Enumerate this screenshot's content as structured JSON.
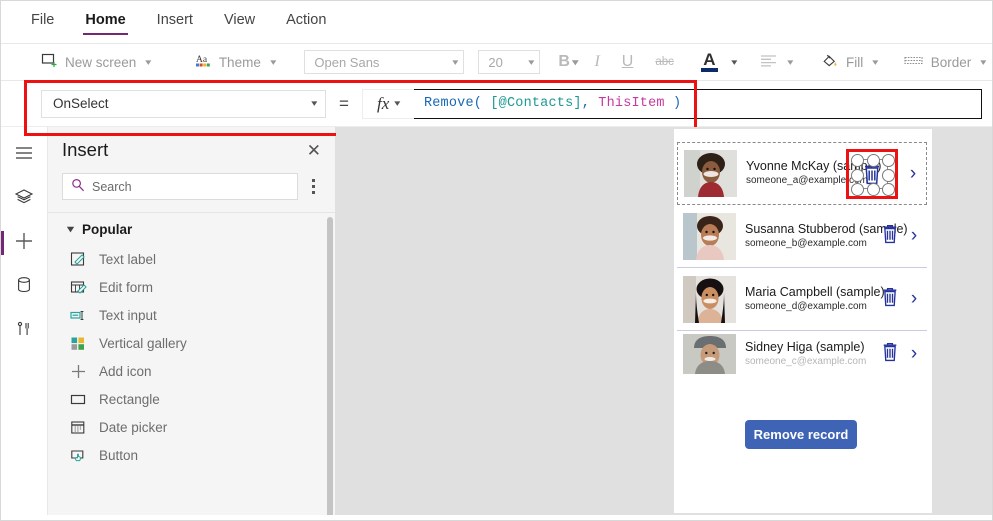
{
  "app": {
    "name": "Power Apps Studio",
    "accent": "#742774",
    "canvas_bg": "#e0e0e0",
    "annotation_color": "#ee1111"
  },
  "menubar": {
    "items": [
      {
        "label": "File",
        "active": false
      },
      {
        "label": "Home",
        "active": true
      },
      {
        "label": "Insert",
        "active": false
      },
      {
        "label": "View",
        "active": false
      },
      {
        "label": "Action",
        "active": false
      }
    ]
  },
  "toolbar": {
    "new_screen": "New screen",
    "theme": "Theme",
    "font_name": "Open Sans",
    "font_size": "20",
    "bold": "B",
    "italic": "I",
    "underline": "U",
    "strikethrough": "abc",
    "font_color": "A",
    "align": "align",
    "fill": "Fill",
    "border": "Border"
  },
  "formula_bar": {
    "property": "OnSelect",
    "equals": "=",
    "fx": "fx",
    "formula_tokens": [
      {
        "text": "Remove(",
        "color": "#1767b5"
      },
      {
        "text": " ",
        "color": "#1b1b1b"
      },
      {
        "text": "[@Contacts]",
        "color": "#1b9a93"
      },
      {
        "text": ", ",
        "color": "#1767b5"
      },
      {
        "text": "ThisItem",
        "color": "#c7399b"
      },
      {
        "text": " )",
        "color": "#1767b5"
      }
    ],
    "formula_plain": "Remove( [@Contacts], ThisItem )"
  },
  "rail": {
    "items": [
      {
        "name": "hamburger-menu-icon",
        "label": "Menu"
      },
      {
        "name": "tree-view-icon",
        "label": "Tree view"
      },
      {
        "name": "insert-icon",
        "label": "Insert",
        "selected": true
      },
      {
        "name": "data-icon",
        "label": "Data"
      },
      {
        "name": "tools-icon",
        "label": "Advanced"
      }
    ]
  },
  "insert_panel": {
    "title": "Insert",
    "close": "✕",
    "search_placeholder": "Search",
    "group": {
      "label": "Popular",
      "expanded": true
    },
    "items": [
      {
        "label": "Text label",
        "icon": "text-label-icon"
      },
      {
        "label": "Edit form",
        "icon": "edit-form-icon"
      },
      {
        "label": "Text input",
        "icon": "text-input-icon"
      },
      {
        "label": "Vertical gallery",
        "icon": "vertical-gallery-icon"
      },
      {
        "label": "Add icon",
        "icon": "add-icon"
      },
      {
        "label": "Rectangle",
        "icon": "rectangle-icon"
      },
      {
        "label": "Date picker",
        "icon": "date-picker-icon"
      },
      {
        "label": "Button",
        "icon": "button-icon"
      }
    ]
  },
  "gallery": {
    "rows": [
      {
        "name": "Yvonne McKay (sample)",
        "email": "someone_a@example.com",
        "selected": true
      },
      {
        "name": "Susanna Stubberod (sample)",
        "email": "someone_b@example.com",
        "selected": false
      },
      {
        "name": "Maria Campbell (sample)",
        "email": "someone_d@example.com",
        "selected": false
      },
      {
        "name": "Sidney Higa (sample)",
        "email": "someone_c@example.com",
        "selected": false
      }
    ],
    "remove_button": "Remove record",
    "remove_button_color": "#3f63b5",
    "trash_icon_color": "#26329b",
    "carat_icon_color": "#26329b"
  }
}
